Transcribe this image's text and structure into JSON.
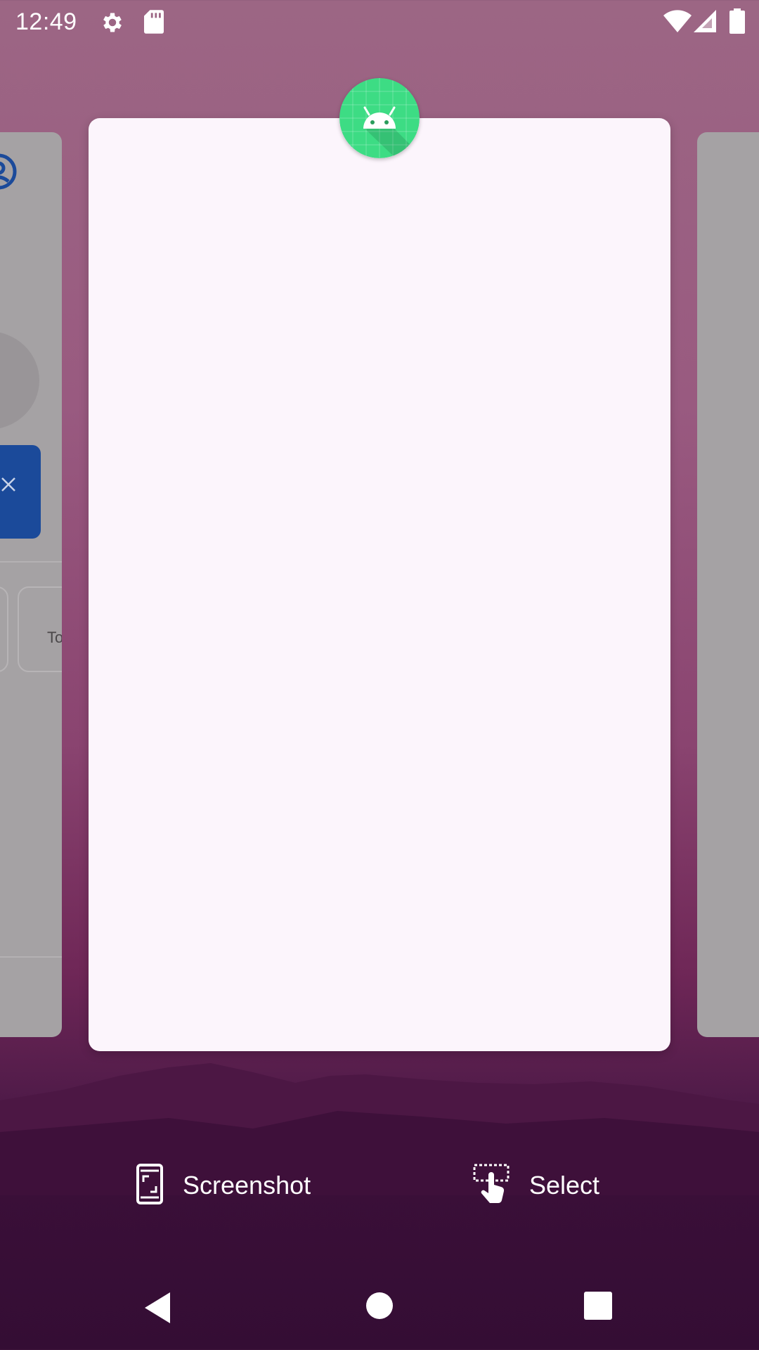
{
  "status_bar": {
    "time": "12:49",
    "icons": [
      "gear-icon",
      "sd-card-icon",
      "wifi-icon",
      "signal-icon",
      "battery-icon"
    ]
  },
  "recents": {
    "left_card_fragment_text": "To",
    "main_card_app_icon": "android-app-icon"
  },
  "actions": {
    "screenshot_label": "Screenshot",
    "select_label": "Select"
  },
  "nav": {
    "buttons": [
      "back-icon",
      "home-icon",
      "recents-icon"
    ]
  },
  "colors": {
    "card_background": "#fcf5fc",
    "side_card": "#a5a2a4",
    "left_card_button": "#1b4a9a",
    "android_green": "#3ddc84"
  }
}
